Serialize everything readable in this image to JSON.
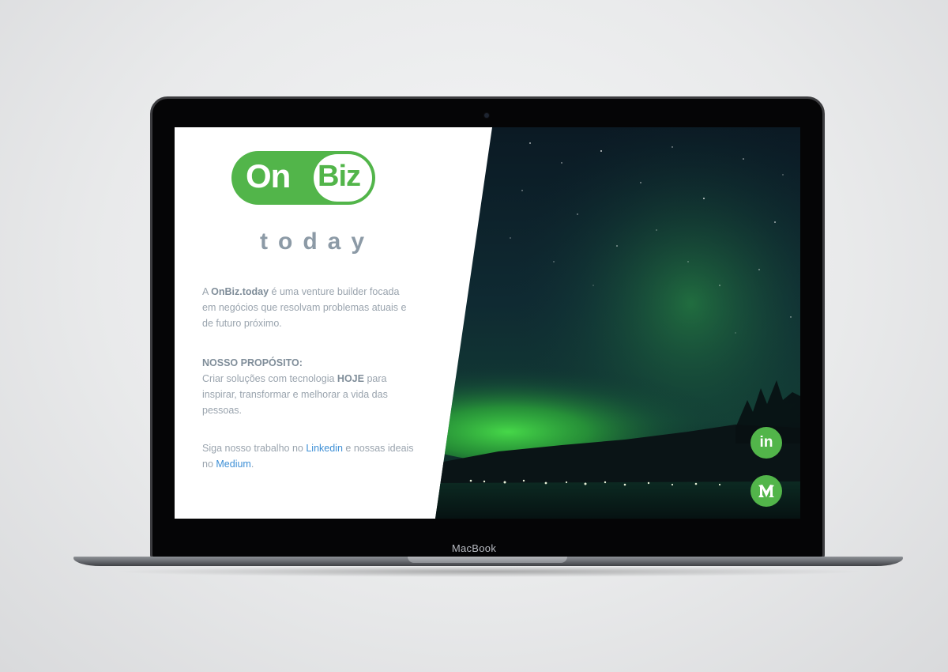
{
  "device": {
    "label": "MacBook"
  },
  "logo": {
    "on": "On",
    "biz": "Biz",
    "today": "today"
  },
  "intro": {
    "prefix": "A ",
    "brand": "OnBiz.today",
    "rest": " é uma venture builder focada em negócios que resolvam problemas atuais e de futuro próximo."
  },
  "purpose": {
    "heading": "NOSSO PROPÓSITO:",
    "text_before": "Criar soluções com tecnologia ",
    "emphasis": "HOJE",
    "text_after": " para inspirar, transformar e melhorar a vida das pessoas."
  },
  "follow": {
    "text_before": "Siga nosso trabalho no ",
    "linkedin_link": "Linkedin",
    "text_middle": " e nossas ideais no ",
    "medium_link": "Medium",
    "text_after": "."
  },
  "social": {
    "linkedin_icon": "in",
    "medium_icon": "M"
  },
  "colors": {
    "brand_green": "#52b54a",
    "text_gray": "#9aa4ae",
    "link_blue": "#3d8fd6",
    "today_gray": "#8c9aa6"
  },
  "icons": {
    "linkedin": "linkedin-icon",
    "medium": "medium-icon"
  }
}
